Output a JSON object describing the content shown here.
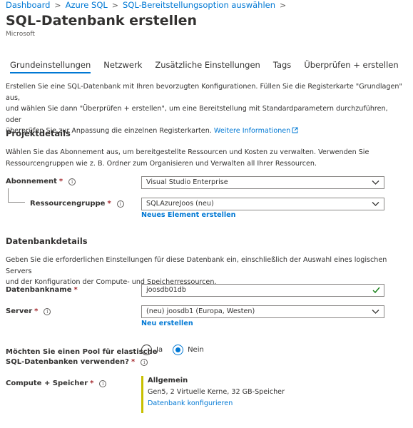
{
  "breadcrumb": {
    "items": [
      "Dashboard",
      "Azure SQL",
      "SQL-Bereitstellungsoption auswählen"
    ]
  },
  "header": {
    "title": "SQL-Datenbank erstellen",
    "publisher": "Microsoft"
  },
  "tabs": [
    {
      "label": "Grundeinstellungen",
      "active": true
    },
    {
      "label": "Netzwerk",
      "active": false
    },
    {
      "label": "Zusätzliche Einstellungen",
      "active": false
    },
    {
      "label": "Tags",
      "active": false
    },
    {
      "label": "Überprüfen + erstellen",
      "active": false
    }
  ],
  "intro": {
    "line1": "Erstellen Sie eine SQL-Datenbank mit Ihren bevorzugten Konfigurationen. Füllen Sie die Registerkarte \"Grundlagen\" aus,",
    "line2": "und wählen Sie dann \"Überprüfen + erstellen\", um eine Bereitstellung mit Standardparametern durchzuführen, oder",
    "line3": "überprüfen Sie zur Anpassung die einzelnen Registerkarten.",
    "link": "Weitere Informationen"
  },
  "project": {
    "title": "Projektdetails",
    "desc_line1": "Wählen Sie das Abonnement aus, um bereitgestellte Ressourcen und Kosten zu verwalten. Verwenden Sie",
    "desc_line2": "Ressourcengruppen wie z. B. Ordner zum Organisieren und Verwalten all Ihrer Ressourcen.",
    "subscription_label": "Abonnement",
    "subscription_value": "Visual Studio Enterprise",
    "resource_group_label": "Ressourcengruppe",
    "resource_group_value": "SQLAzureJoos (neu)",
    "new_resource_group": "Neues Element erstellen"
  },
  "database": {
    "title": "Datenbankdetails",
    "desc_line1": "Geben Sie die erforderlichen Einstellungen für diese Datenbank ein, einschließlich der Auswahl eines logischen Servers",
    "desc_line2": "und der Konfiguration der Compute- und Speicherressourcen.",
    "name_label": "Datenbankname",
    "name_value": "joosdb01db",
    "server_label": "Server",
    "server_value": "(neu) joosdb1 (Europa, Westen)",
    "new_server": "Neu erstellen",
    "pool_label_line1": "Möchten Sie einen Pool für elastische",
    "pool_label_line2": "SQL-Datenbanken verwenden?",
    "pool_yes": "Ja",
    "pool_no": "Nein",
    "pool_selected": "Nein",
    "compute_label": "Compute + Speicher",
    "compute_tier": "Allgemein",
    "compute_specs": "Gen5, 2 Virtuelle Kerne, 32 GB-Speicher",
    "compute_configure": "Datenbank konfigurieren"
  },
  "colors": {
    "accent": "#0078d4",
    "required": "#a4262c",
    "valid": "#107c10",
    "compute_bar": "#c8c000"
  }
}
